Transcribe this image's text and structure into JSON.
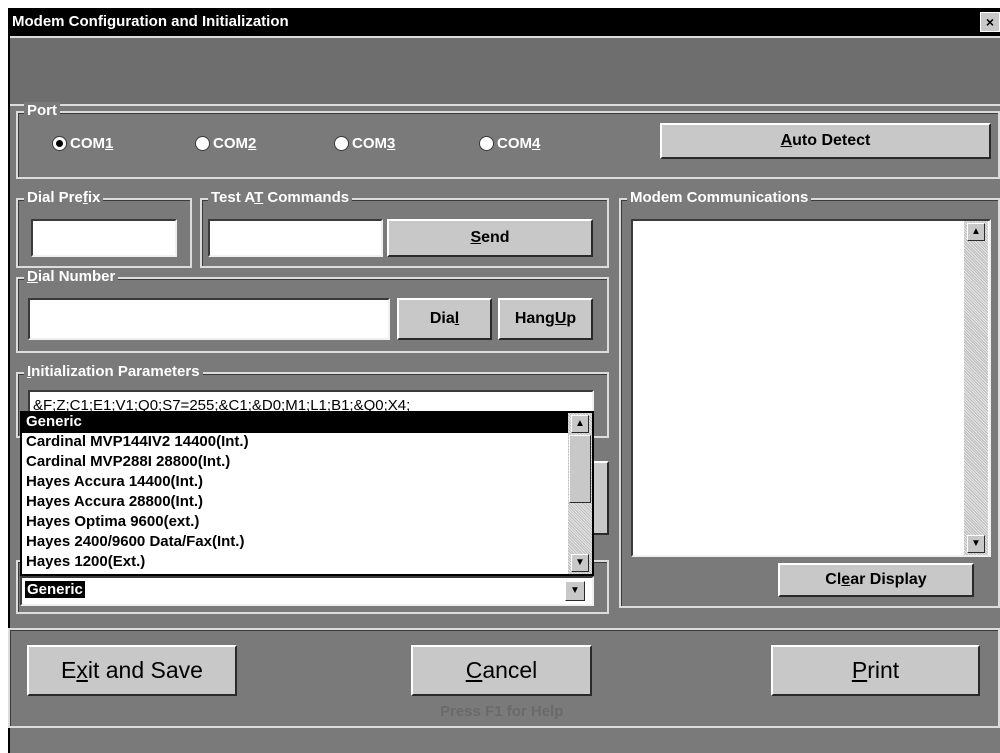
{
  "window": {
    "title": "Modem Configuration and Initialization",
    "close_glyph": "×"
  },
  "port": {
    "legend": "Port",
    "options": [
      {
        "pre": "COM",
        "key": "1",
        "post": "",
        "selected": true
      },
      {
        "pre": "COM",
        "key": "2",
        "post": "",
        "selected": false
      },
      {
        "pre": "COM",
        "key": "3",
        "post": "",
        "selected": false
      },
      {
        "pre": "COM",
        "key": "4",
        "post": "",
        "selected": false
      }
    ],
    "auto_detect": {
      "pre": "",
      "key": "A",
      "post": "uto Detect"
    }
  },
  "dial_prefix": {
    "legend_pre": "Dial Pre",
    "legend_key": "f",
    "legend_post": "ix",
    "value": ""
  },
  "test_at": {
    "legend_pre": "Test A",
    "legend_key": "T",
    "legend_post": " Commands",
    "value": "",
    "send": {
      "pre": "",
      "key": "S",
      "post": "end"
    }
  },
  "dial_number": {
    "legend_pre": "",
    "legend_key": "D",
    "legend_post": "ial Number",
    "value": "",
    "dial": {
      "pre": "Dia",
      "key": "l",
      "post": ""
    },
    "hangup": {
      "pre": "Hang ",
      "key": "U",
      "post": "p"
    }
  },
  "init_params": {
    "legend_pre": "",
    "legend_key": "I",
    "legend_post": "nitialization Parameters",
    "value": "&F;Z;C1;E1;V1;Q0;S7=255;&C1;&D0;M1;L1;B1;&Q0;X4;"
  },
  "modem_list": {
    "items": [
      "Generic",
      "Cardinal MVP144IV2 14400(Int.)",
      "Cardinal MVP288I 28800(Int.)",
      "Hayes Accura 14400(Int.)",
      "Hayes Accura 28800(Int.)",
      "Hayes Optima 9600(ext.)",
      "Hayes 2400/9600 Data/Fax(Int.)",
      "Hayes 1200(Ext.)"
    ],
    "selected_index": 0,
    "combo_value": "Generic"
  },
  "modem_comm": {
    "legend": "Modem Communications",
    "clear": {
      "pre": "Cl",
      "key": "e",
      "post": "ar Display"
    }
  },
  "footer": {
    "exit": {
      "pre": "E",
      "key": "x",
      "post": "it and Save"
    },
    "cancel": {
      "pre": "",
      "key": "C",
      "post": "ancel"
    },
    "print": {
      "pre": "",
      "key": "P",
      "post": "rint"
    },
    "help": "Press F1 for Help"
  },
  "icons": {
    "up": "▲",
    "down": "▼"
  }
}
